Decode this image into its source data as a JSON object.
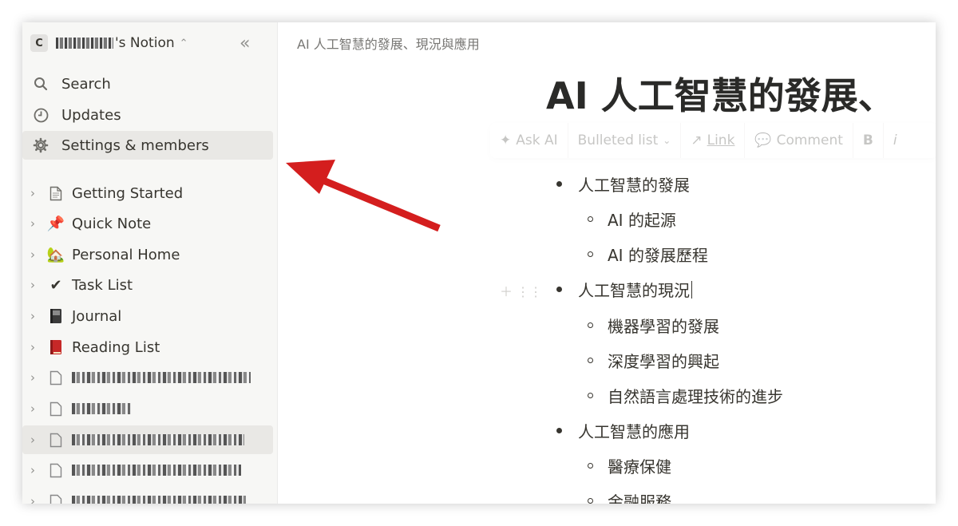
{
  "sidebar": {
    "workspace_initial": "C",
    "workspace_name": "'s Notion",
    "collapse_label": "«",
    "nav": [
      {
        "label": "Search",
        "icon": "search-icon"
      },
      {
        "label": "Updates",
        "icon": "clock-icon"
      },
      {
        "label": "Settings & members",
        "icon": "gear-icon"
      }
    ],
    "pages": [
      {
        "label": "Getting Started",
        "icon": "page-icon"
      },
      {
        "label": "Quick Note",
        "icon": "pushpin-emoji"
      },
      {
        "label": "Personal Home",
        "icon": "house-emoji"
      },
      {
        "label": "Task List",
        "icon": "checkmark-emoji"
      },
      {
        "label": "Journal",
        "icon": "notebook-emoji"
      },
      {
        "label": "Reading List",
        "icon": "book-emoji"
      }
    ]
  },
  "main": {
    "breadcrumb": "AI 人工智慧的發展、現況與應用",
    "title": "AI 人工智慧的發展、",
    "toolbar": [
      "Ask AI",
      "Bulleted list",
      "Link",
      "Comment",
      "B",
      "i"
    ],
    "bullets": [
      {
        "level": 1,
        "text": "人工智慧的發展"
      },
      {
        "level": 2,
        "text": "AI 的起源"
      },
      {
        "level": 2,
        "text": "AI 的發展歷程"
      },
      {
        "level": 1,
        "text": "人工智慧的現況"
      },
      {
        "level": 2,
        "text": "機器學習的發展"
      },
      {
        "level": 2,
        "text": "深度學習的興起"
      },
      {
        "level": 2,
        "text": "自然語言處理技術的進步"
      },
      {
        "level": 1,
        "text": "人工智慧的應用"
      },
      {
        "level": 2,
        "text": "醫療保健"
      },
      {
        "level": 2,
        "text": "金融服務"
      }
    ]
  },
  "annotation": {
    "arrow_color": "#d41e1e"
  }
}
